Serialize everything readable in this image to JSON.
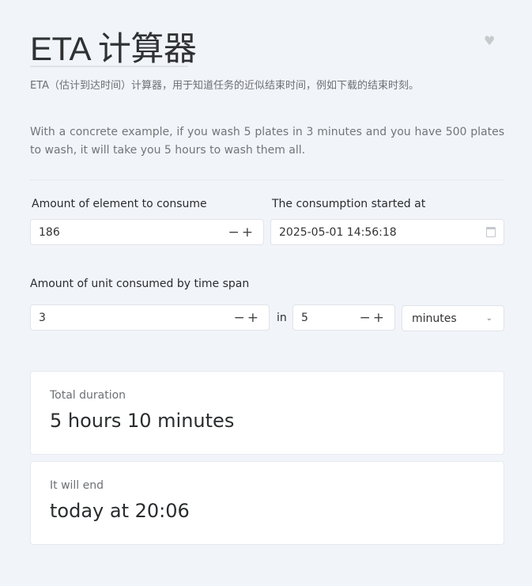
{
  "title": "ETA 计算器",
  "subtitle": "ETA（估计到达时间）计算器，用于知道任务的近似结束时间，例如下载的结束时刻。",
  "description": "With a concrete example, if you wash 5 plates in 3 minutes and you have 500 plates to wash, it will take you 5 hours to wash them all.",
  "form": {
    "amount_label": "Amount of element to consume",
    "amount_value": "186",
    "start_label": "The consumption started at",
    "start_value": "2025-05-01 14:56:18",
    "rate_label": "Amount of unit consumed by time span",
    "rate_value": "3",
    "in_label": "in",
    "span_value": "5",
    "unit_value": "minutes"
  },
  "results": {
    "duration_label": "Total duration",
    "duration_value": "5 hours 10 minutes",
    "end_label": "It will end",
    "end_value": "today at 20:06"
  }
}
